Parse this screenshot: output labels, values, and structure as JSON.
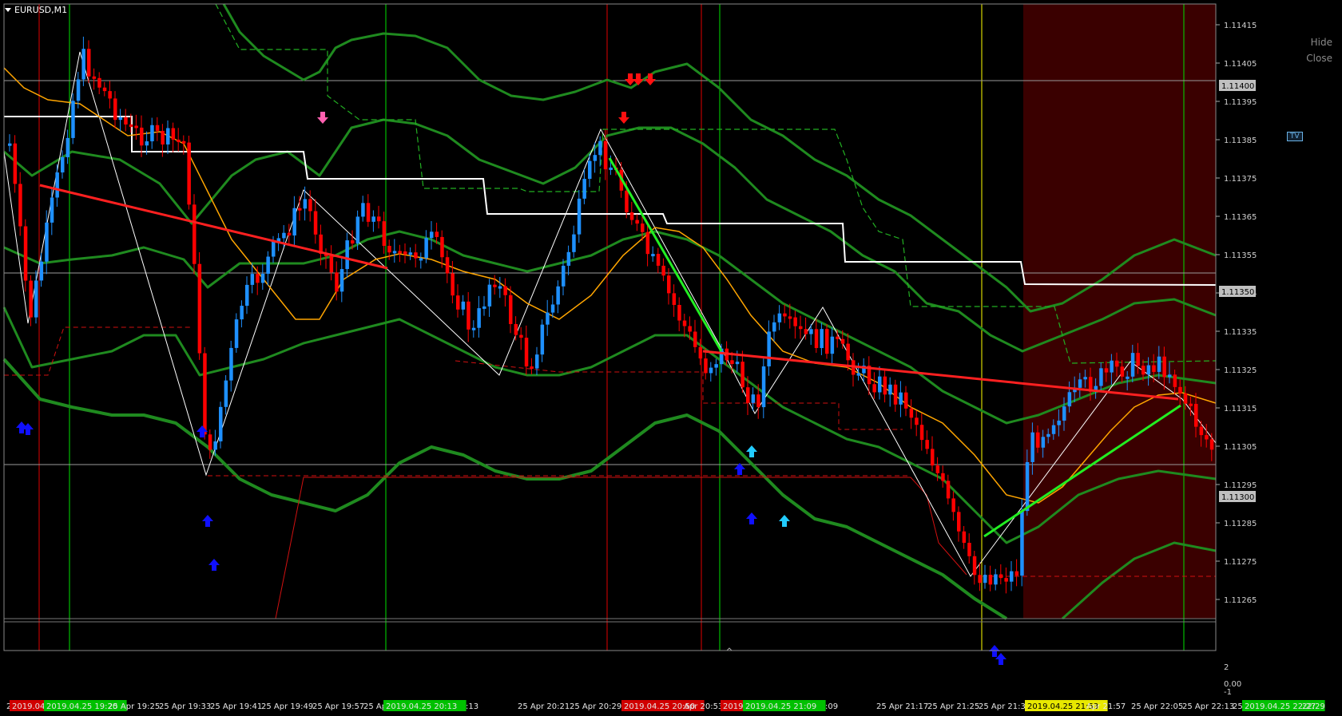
{
  "window": {
    "symbol_label": "EURUSD,M1"
  },
  "panel_buttons": {
    "hide": "Hide",
    "close": "Close",
    "tv": "TV"
  },
  "price_axis": {
    "ticks": [
      "1.11415",
      "1.11405",
      "1.11395",
      "1.11385",
      "1.11375",
      "1.11365",
      "1.11355",
      "1.11345",
      "1.11335",
      "1.11325",
      "1.11315",
      "1.11305",
      "1.11295",
      "1.11285",
      "1.11275",
      "1.11265"
    ],
    "highlights": [
      "1.11400",
      "1.11350",
      "1.11300"
    ]
  },
  "sub_axis": {
    "ticks": [
      "2",
      "0.00",
      "-1"
    ]
  },
  "time_axis": {
    "labels": [
      {
        "t": "25",
        "kind": "plain"
      },
      {
        "t": "2019.04",
        "kind": "red"
      },
      {
        "t": "2019.04.25 19:20",
        "kind": "green"
      },
      {
        "t": "25 Apr 19:25",
        "kind": "plain"
      },
      {
        "t": "25 Apr 19:33",
        "kind": "plain"
      },
      {
        "t": "25 Apr 19:41",
        "kind": "plain"
      },
      {
        "t": "25 Apr 19:49",
        "kind": "plain"
      },
      {
        "t": "25 Apr 19:57",
        "kind": "plain"
      },
      {
        "t": "25 Ap",
        "kind": "plain"
      },
      {
        "t": "2019.04.25 20:13",
        "kind": "green"
      },
      {
        "t": ":13",
        "kind": "plain"
      },
      {
        "t": "25 Apr 20:21",
        "kind": "plain"
      },
      {
        "t": "25 Apr 20:29",
        "kind": "plain"
      },
      {
        "t": "25 Apr 20:37",
        "kind": "plain"
      },
      {
        "t": "2019.04.25 20:50",
        "kind": "red"
      },
      {
        "t": "Apr 20:53",
        "kind": "plain"
      },
      {
        "t": "2019",
        "kind": "red"
      },
      {
        "t": "2019.04.25 21:09",
        "kind": "green"
      },
      {
        "t": ":09",
        "kind": "plain"
      },
      {
        "t": "25 Apr 21:17",
        "kind": "plain"
      },
      {
        "t": "25 Apr 21:25",
        "kind": "plain"
      },
      {
        "t": "25 Apr 21:33",
        "kind": "plain"
      },
      {
        "t": "25 Apr 21:41",
        "kind": "plain"
      },
      {
        "t": "2019.04.25 21:53",
        "kind": "yellow"
      },
      {
        "t": "Apr 21:57",
        "kind": "plain"
      },
      {
        "t": "25 Apr 22:05",
        "kind": "plain"
      },
      {
        "t": "25 Apr 22:13",
        "kind": "plain"
      },
      {
        "t": "25",
        "kind": "plain"
      },
      {
        "t": "2019.04.25 22:27",
        "kind": "green"
      },
      {
        "t": "22:29",
        "kind": "plain"
      }
    ]
  },
  "colors": {
    "background": "#000000",
    "bull_candle": "#1e90ff",
    "bear_candle": "#ff0000",
    "ma_orange": "#ffa500",
    "band_green": "#1f8a1f",
    "trend_red": "#ff2020",
    "trend_green": "#22ee22",
    "vline_green": "#00e000",
    "vline_red": "#e00000",
    "vline_yellow": "#ffff00",
    "shaded_zone": "#3a0000"
  }
}
